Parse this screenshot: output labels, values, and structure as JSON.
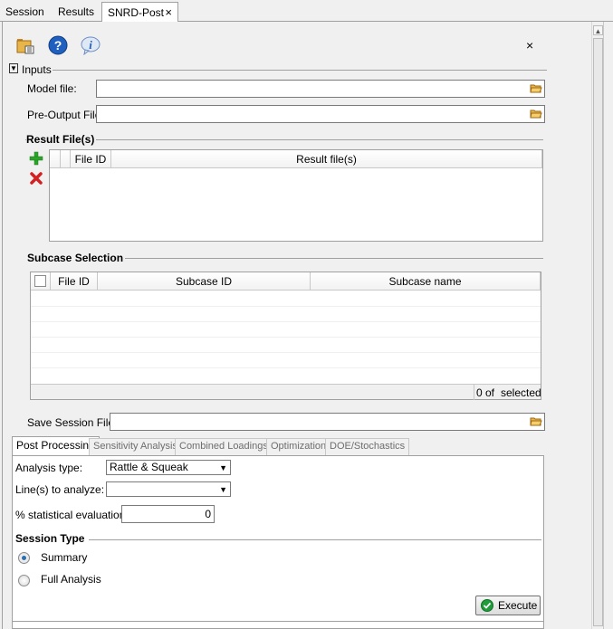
{
  "top_tabs": [
    "Session",
    "Results",
    "SNRD-Post"
  ],
  "close_glyph": "×",
  "inputs": {
    "header": "Inputs",
    "model_file_label": "Model file:",
    "pre_output_label": "Pre-Output File",
    "model_file_value": "",
    "pre_output_value": ""
  },
  "result_files": {
    "heading": "Result File(s)",
    "columns": [
      "File ID",
      "Result file(s)"
    ]
  },
  "subcase": {
    "heading": "Subcase Selection",
    "columns": [
      "File ID",
      "Subcase ID",
      "Subcase name"
    ],
    "count_value": "0 of",
    "count_suffix": "selected"
  },
  "save_session": {
    "label": "Save Session File:",
    "value": ""
  },
  "bottom_tabs": [
    "Post Processing",
    "Sensitivity Analysis",
    "Combined Loadings",
    "Optimization",
    "DOE/Stochastics"
  ],
  "post": {
    "analysis_type_label": "Analysis type:",
    "analysis_type_value": "Rattle & Squeak",
    "lines_label": "Line(s) to analyze:",
    "lines_value": "",
    "stat_label": "% statistical evaluation:",
    "stat_value": "0",
    "session_type_heading": "Session Type",
    "radio_summary": "Summary",
    "radio_full": "Full Analysis",
    "execute_label": "Execute"
  },
  "icons": [
    "open-folder-icon",
    "help-icon",
    "info-icon",
    "add-icon",
    "delete-icon",
    "check-icon"
  ],
  "colors": {
    "accent_blue": "#2a6fb0",
    "add_green": "#2aa52a",
    "delete_red": "#d32020",
    "execute_green": "#1f9d3a"
  }
}
